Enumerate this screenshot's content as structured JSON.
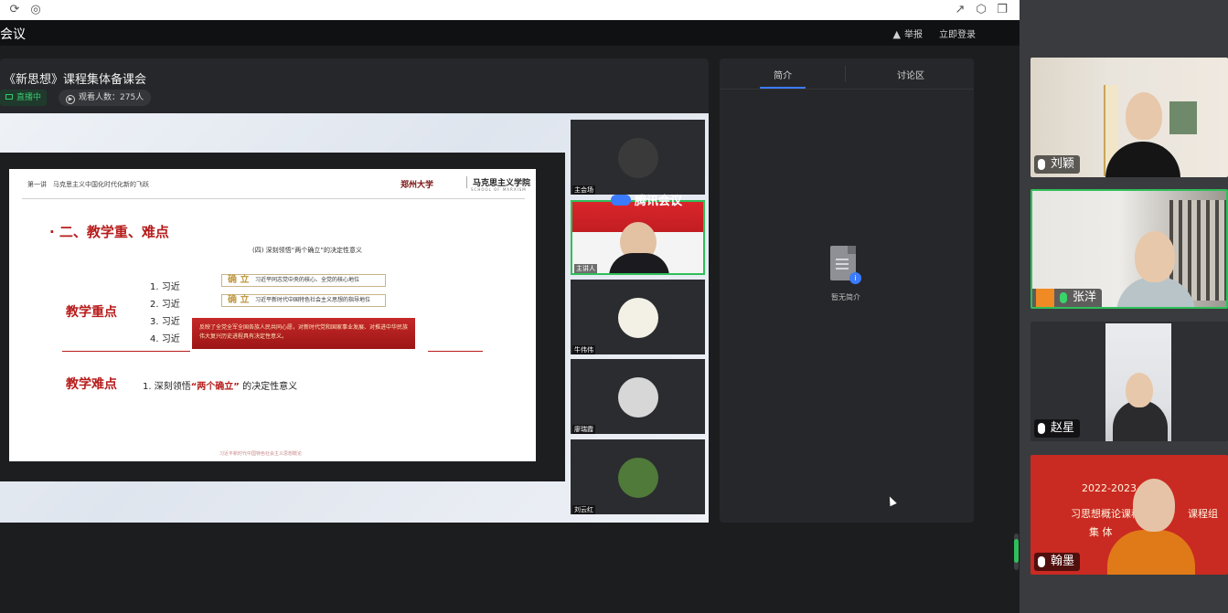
{
  "app": {
    "title": "会议"
  },
  "header": {
    "report": "举报",
    "login": "立即登录"
  },
  "stream": {
    "title": "《新思想》课程集体备课会",
    "live_badge": "直播中",
    "viewers": "观看人数：275人"
  },
  "slide": {
    "topline": "第一讲　马克思主义中国化时代化新的飞跃",
    "school_a": "郑州大学",
    "school_b": "马克思主义学院",
    "school_sub": "SCHOOL OF MARXISM",
    "heading": "· 二、教学重、难点",
    "subheading": "(四) 深刻领悟“两个确立”的决定性意义",
    "key_label": "教学重点",
    "difficulty_label": "教学难点",
    "items": [
      "1. 习近",
      "2. 习近",
      "3. 习近",
      "4. 习近"
    ],
    "tag_word": "确 立",
    "tags": [
      "习近平同志党中央的核心、全党的核心地位",
      "习近平新时代中国特色社会主义思想的指导地位"
    ],
    "red_box": "反映了全党全军全国各族人民共同心愿，对新时代党和国家事业发展、对推进中华民族伟大复兴历史进程具有决定性意义。",
    "difficulty_prefix": "1.  深刻领悟",
    "difficulty_em": "“两个确立”",
    "difficulty_suffix": " 的决定性意义",
    "footer": "习近平新时代中国特色社会主义思想概论"
  },
  "watermark": "腾讯会议",
  "tiles": [
    {
      "name": "主会场"
    },
    {
      "name": "主讲人"
    },
    {
      "name": "牛伟伟"
    },
    {
      "name": "廖瑞霞"
    },
    {
      "name": "刘云红"
    }
  ],
  "intro": {
    "tab_intro": "简介",
    "tab_discuss": "讨论区",
    "empty": "暂无简介"
  },
  "participants": [
    {
      "name": "刘颖"
    },
    {
      "name": "张洋"
    },
    {
      "name": "赵星"
    },
    {
      "name": "翰墨",
      "bg_line1": "2022-2023",
      "bg_line2": "习思想概论课程组",
      "bg_line3": "课程组",
      "bg_line4": "集 体"
    }
  ],
  "colors": {
    "accent": "#3a7bff",
    "live": "#2fbf5a",
    "slide_red": "#b71c1c"
  }
}
